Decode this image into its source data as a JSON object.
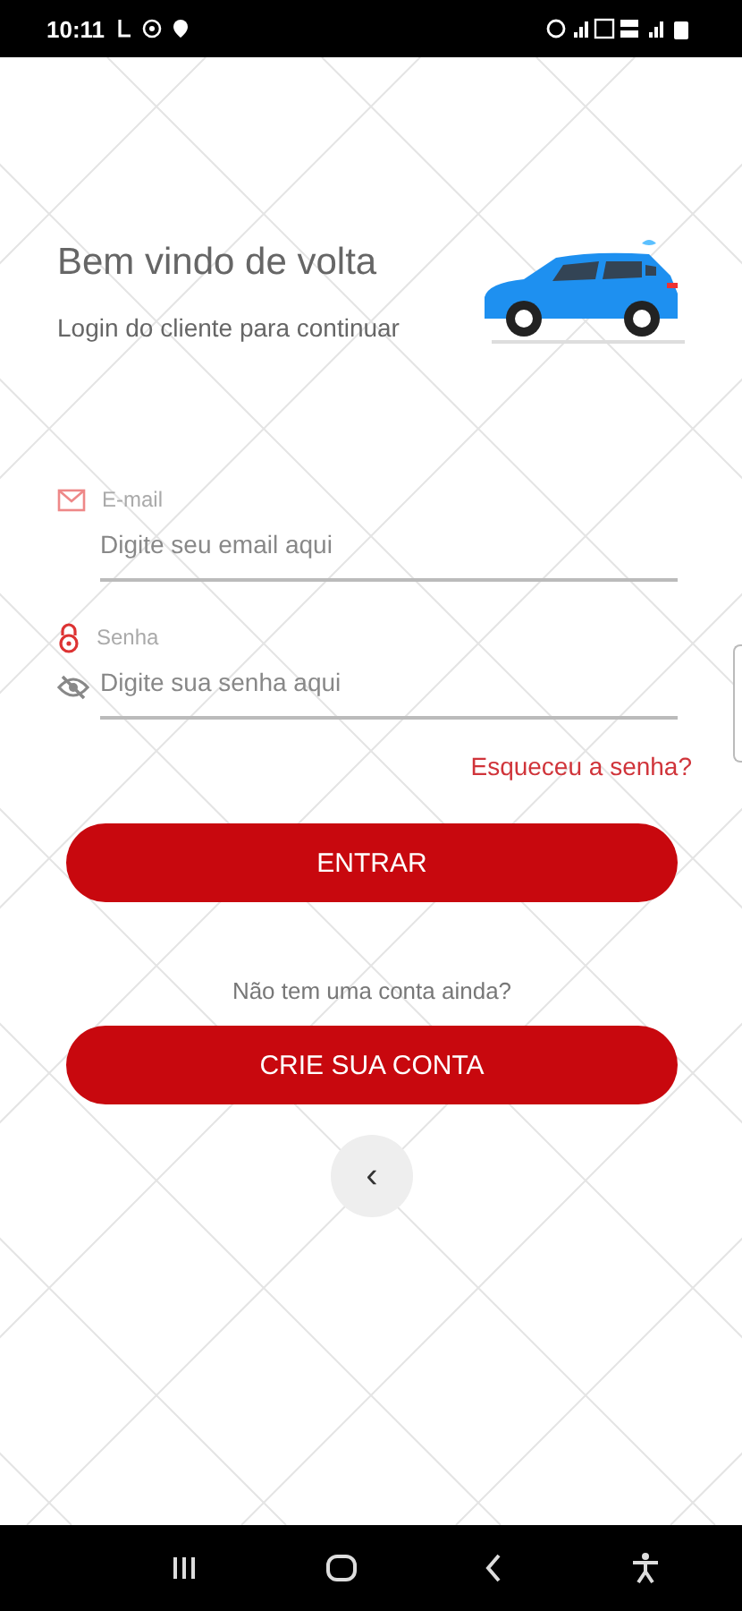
{
  "status_bar": {
    "time": "10:11"
  },
  "header": {
    "title": "Bem vindo de volta",
    "subtitle": "Login do cliente para continuar"
  },
  "fields": [
    {
      "kind": "email",
      "label": "E-mail",
      "placeholder": "Digite seu email aqui"
    },
    {
      "kind": "password",
      "label": "Senha",
      "placeholder": "Digite sua senha aqui"
    }
  ],
  "forgot_link": "Esqueceu a senha?",
  "login_button": "ENTRAR",
  "signup_prompt": "Não tem uma conta ainda?",
  "signup_button": "CRIE SUA CONTA",
  "back_button": "‹"
}
